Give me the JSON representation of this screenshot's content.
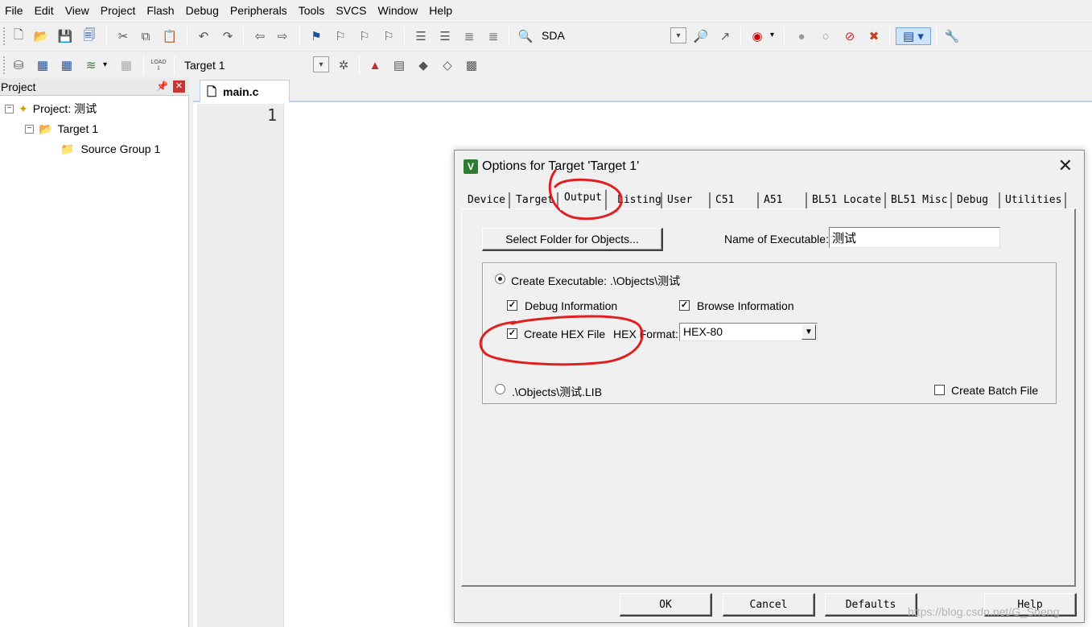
{
  "menu": [
    "File",
    "Edit",
    "View",
    "Project",
    "Flash",
    "Debug",
    "Peripherals",
    "Tools",
    "SVCS",
    "Window",
    "Help"
  ],
  "toolbar1": {
    "find_text": "SDA"
  },
  "toolbar2": {
    "target_combo": "Target 1",
    "load_label": "LOAD"
  },
  "project": {
    "header": "Project",
    "root": "Project: 测试",
    "target": "Target 1",
    "group": "Source Group 1"
  },
  "editor": {
    "tab": "main.c",
    "line_number": "1"
  },
  "dialog": {
    "title": "Options for Target 'Target 1'",
    "tabs": [
      "Device",
      "Target",
      "Output",
      "Listing",
      "User",
      "C51",
      "A51",
      "BL51 Locate",
      "BL51 Misc",
      "Debug",
      "Utilities"
    ],
    "active_tab": "Output",
    "select_folder_button": "Select Folder for Objects...",
    "name_exec_label": "Name of Executable:",
    "name_exec_value": "测试",
    "create_exec_label": "Create Executable:  .\\Objects\\测试",
    "create_exec_selected": true,
    "debug_info_label": "Debug Information",
    "debug_info_checked": true,
    "browse_info_label": "Browse Information",
    "browse_info_checked": true,
    "create_hex_label": "Create HEX File",
    "create_hex_checked": true,
    "hex_format_label": "HEX Format:",
    "hex_format_value": "HEX-80",
    "lib_label": ".\\Objects\\测试.LIB",
    "lib_selected": false,
    "batch_label": "Create Batch File",
    "batch_checked": false,
    "ok_button": "OK",
    "cancel_button": "Cancel",
    "defaults_button": "Defaults",
    "help_button": "Help"
  },
  "watermark": "https://blog.csdn.net/G_Sheng",
  "colors": {
    "annotation_red": "#e02020",
    "selection_blue": "#b9d1ea"
  }
}
